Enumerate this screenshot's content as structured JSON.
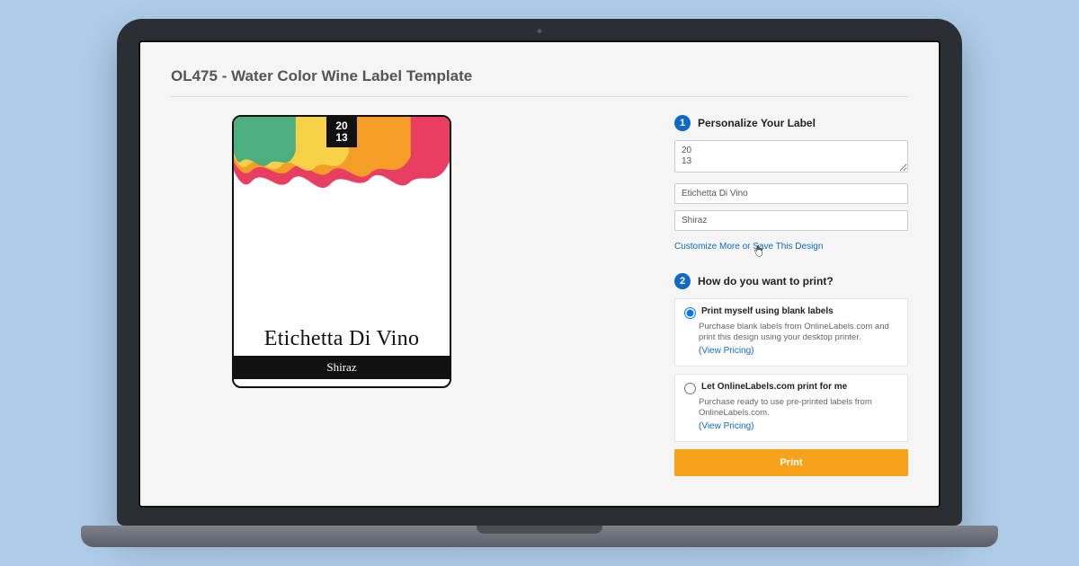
{
  "page": {
    "title": "OL475 - Water Color Wine Label Template"
  },
  "label_preview": {
    "year_line1": "20",
    "year_line2": "13",
    "title": "Etichetta Di Vino",
    "subtitle": "Shiraz"
  },
  "form": {
    "step1": {
      "badge": "1",
      "title": "Personalize Your Label",
      "year_value": "20\n13",
      "title_value": "Etichetta Di Vino",
      "subtitle_value": "Shiraz",
      "customize_link": "Customize More or Save This Design"
    },
    "step2": {
      "badge": "2",
      "title": "How do you want to print?",
      "options": [
        {
          "label": "Print myself using blank labels",
          "description": "Purchase blank labels from OnlineLabels.com and print this design using your desktop printer.",
          "pricing_link": "(View Pricing)",
          "selected": true
        },
        {
          "label": "Let OnlineLabels.com print for me",
          "description": "Purchase ready to use pre-printed labels from OnlineLabels.com.",
          "pricing_link": "(View Pricing)",
          "selected": false
        }
      ],
      "print_button": "Print"
    }
  }
}
